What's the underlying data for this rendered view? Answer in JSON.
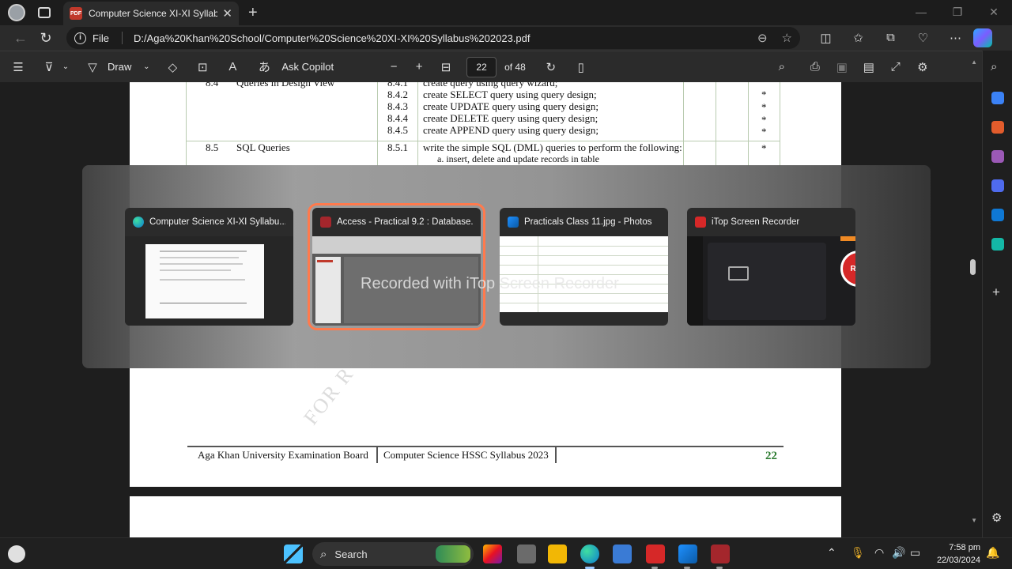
{
  "browser": {
    "tab_title": "Computer Science XI-XI Syllabus",
    "tab_badge": "PDF",
    "file_label": "File",
    "url": "D:/Aga%20Khan%20School/Computer%20Science%20XI-XI%20Syllabus%202023.pdf"
  },
  "pdf_toolbar": {
    "draw_label": "Draw",
    "ask_copilot_label": "Ask Copilot",
    "current_page": "22",
    "total_pages": "of 48"
  },
  "document": {
    "rows": [
      {
        "code": "8.4",
        "topic": "Queries in Design View",
        "sub": "8.4.1",
        "text": "create query using query wizard;",
        "star": "*"
      },
      {
        "code": "",
        "topic": "",
        "sub": "8.4.2",
        "text": "create SELECT query using query design;",
        "star": "*"
      },
      {
        "code": "",
        "topic": "",
        "sub": "8.4.3",
        "text": "create UPDATE query using query design;",
        "star": "*"
      },
      {
        "code": "",
        "topic": "",
        "sub": "8.4.4",
        "text": "create DELETE query using query design;",
        "star": "*"
      },
      {
        "code": "",
        "topic": "",
        "sub": "8.4.5",
        "text": "create APPEND query using query design;",
        "star": "*"
      },
      {
        "code": "8.5",
        "topic": "SQL Queries",
        "sub": "8.5.1",
        "text": "write the simple SQL (DML) queries to perform the following:",
        "star": "*"
      }
    ],
    "subitem": "a.   insert, delete and update records in table",
    "footer_left": "Aga Khan University Examination Board",
    "footer_mid": "Computer Science HSSC Syllabus 2023",
    "footer_page": "22",
    "watermark": "FOR R"
  },
  "task_switcher": {
    "cards": [
      {
        "title": "Computer Science XI-XI Syllabu...",
        "active": false
      },
      {
        "title": "Access - Practical 9.2 : Database...",
        "active": true
      },
      {
        "title": "Practicals Class 11.jpg - Photos",
        "active": false
      },
      {
        "title": "iTop Screen Recorder",
        "active": false
      }
    ],
    "rec_label": "REC",
    "recorded_overlay": "Recorded with iTop Screen Recorder"
  },
  "taskbar": {
    "search_label": "Search",
    "time": "7:58 pm",
    "date": "22/03/2024"
  },
  "colors": {
    "accent_active": "#ff7a4d",
    "footer_page_green": "#2e7d32",
    "rec_red": "#d62828"
  }
}
